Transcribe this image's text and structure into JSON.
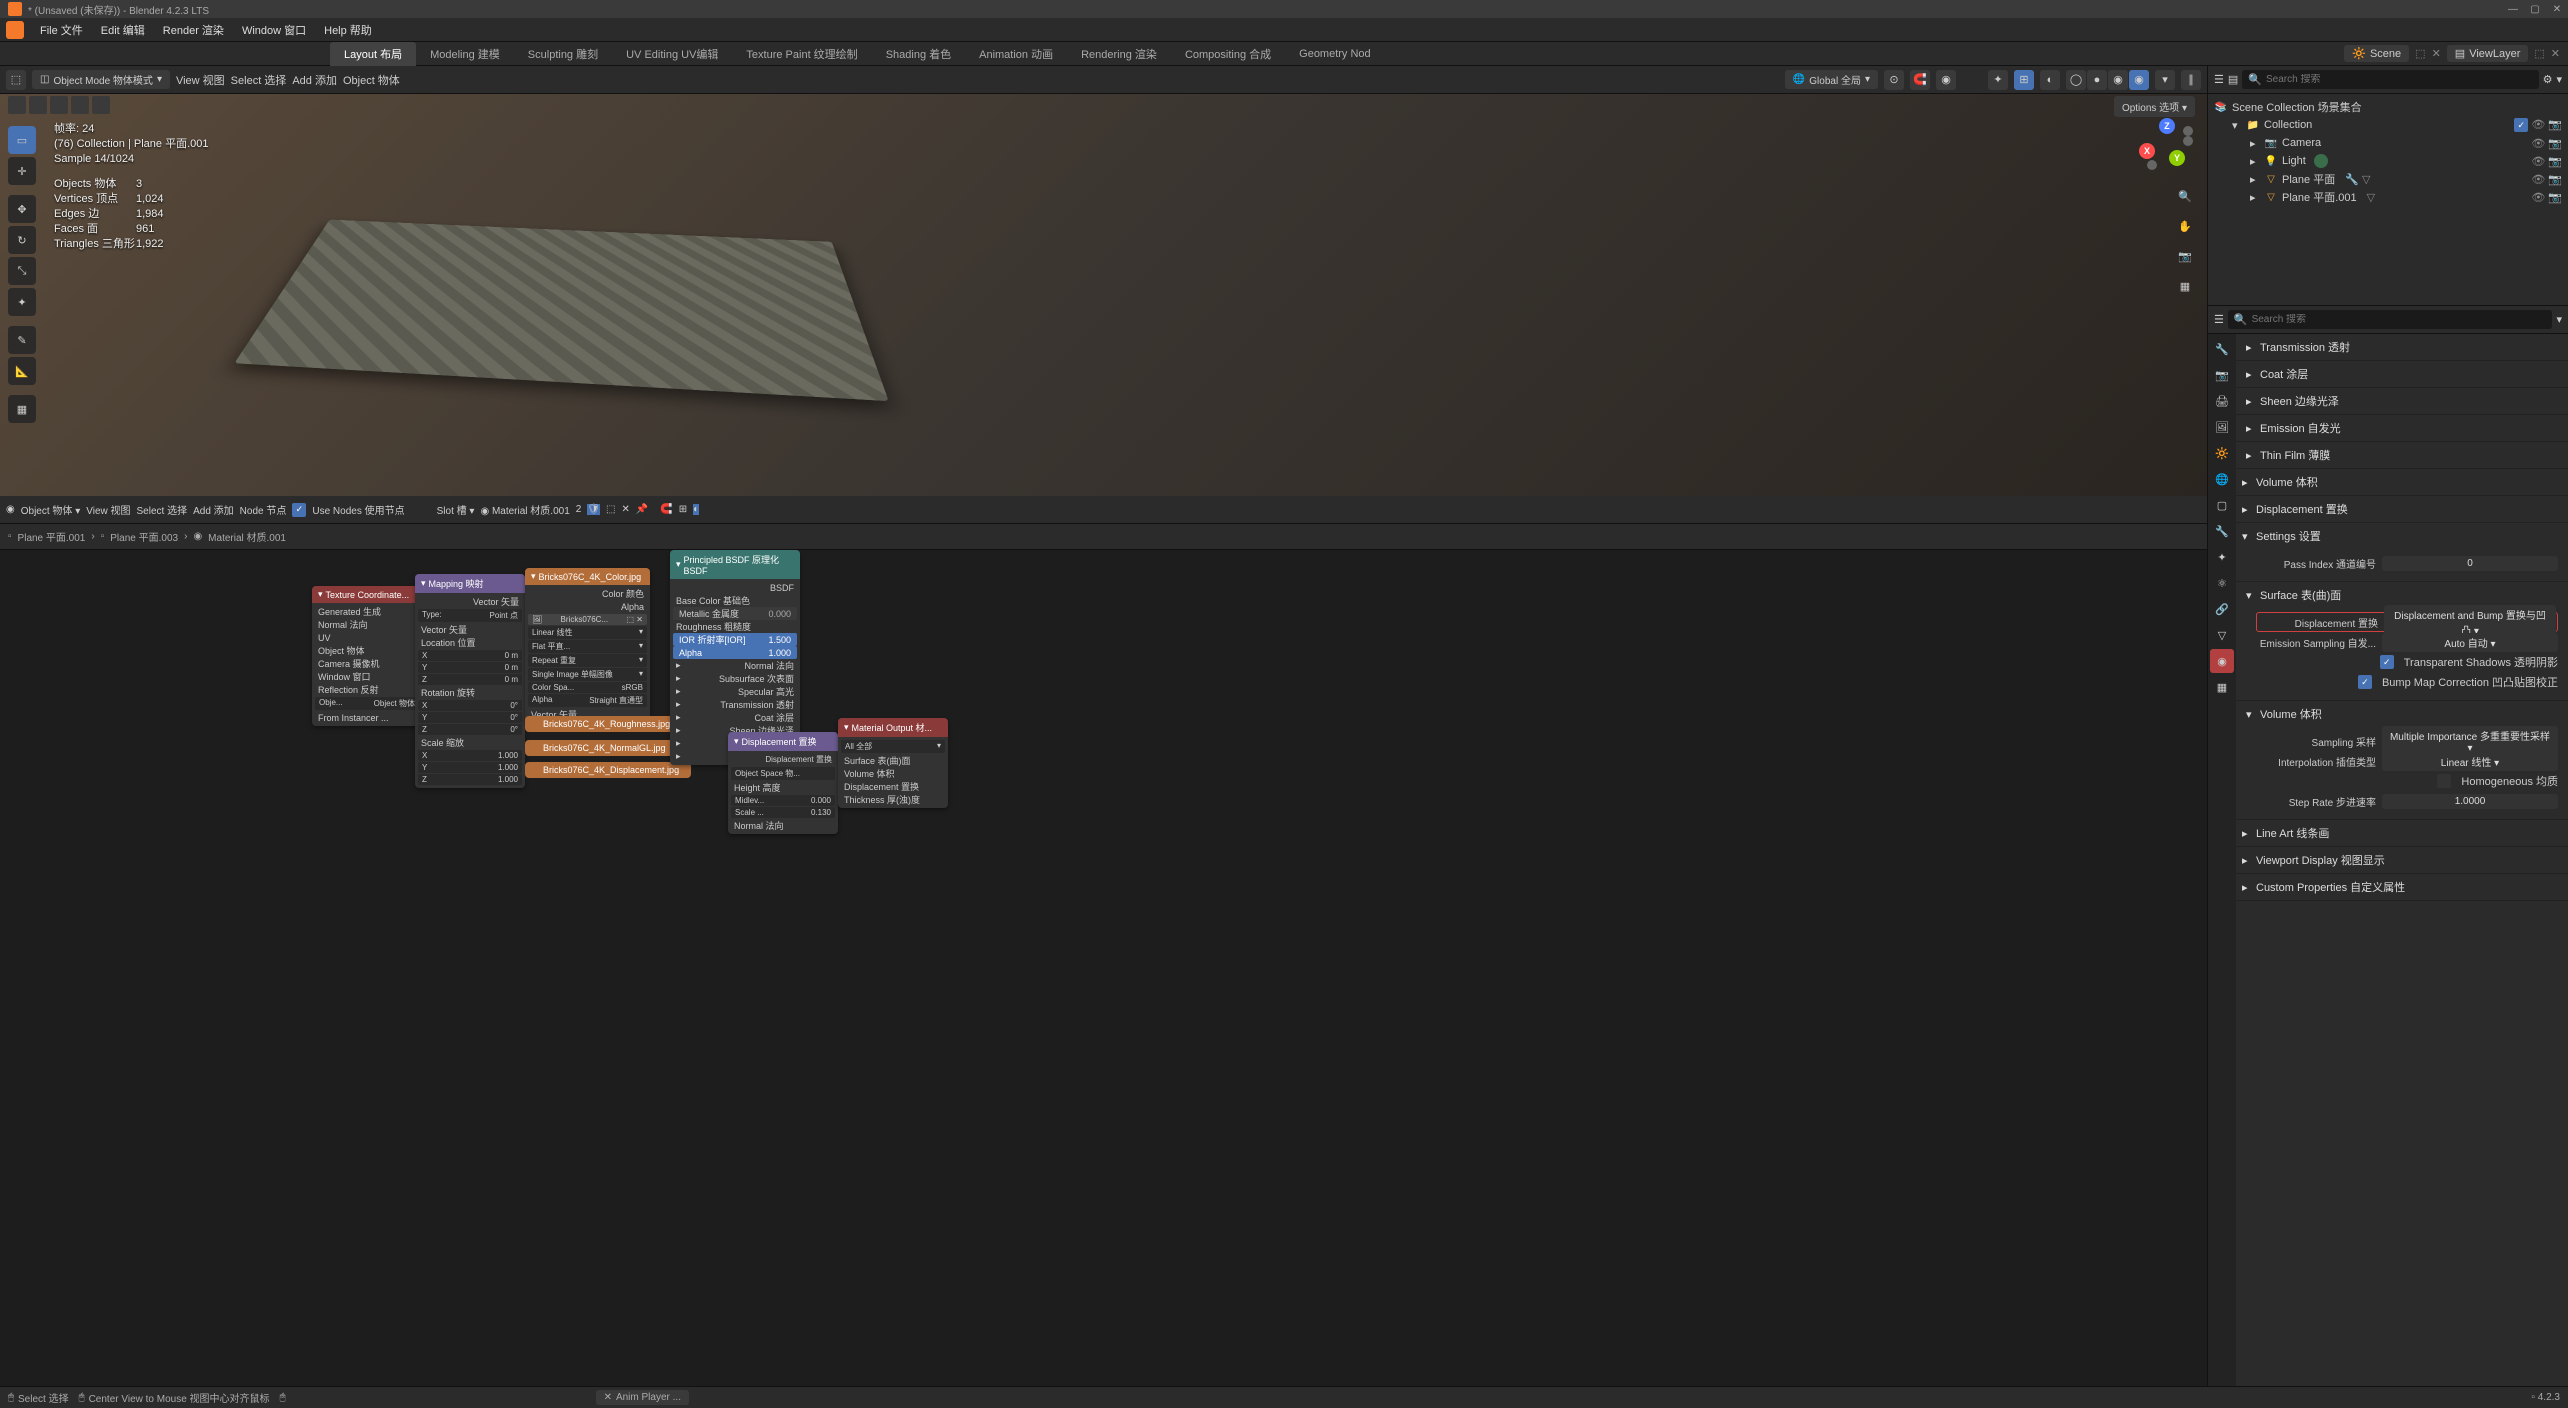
{
  "app": {
    "title": "* (Unsaved (未保存)) - Blender 4.2.3 LTS",
    "version": "4.2.3"
  },
  "menu": [
    "File 文件",
    "Edit 编辑",
    "Render 渲染",
    "Window 窗口",
    "Help 帮助"
  ],
  "workspaces": [
    "Layout 布局",
    "Modeling 建模",
    "Sculpting 雕刻",
    "UV Editing UV编辑",
    "Texture Paint 纹理绘制",
    "Shading 着色",
    "Animation 动画",
    "Rendering 渲染",
    "Compositing 合成",
    "Geometry Nod"
  ],
  "scene_field": "Scene",
  "viewlayer_field": "ViewLayer",
  "viewport_header": {
    "mode": "Object Mode 物体模式",
    "view": "View 视图",
    "select": "Select 选择",
    "add": "Add 添加",
    "object": "Object 物体",
    "orientation": "Global 全局",
    "options": "Options 选项"
  },
  "vp_info": {
    "fps": "帧率: 24",
    "path": "(76) Collection | Plane 平面.001",
    "sample": "Sample 14/1024",
    "stats": [
      {
        "l": "Objects 物体",
        "v": "3"
      },
      {
        "l": "Vertices 顶点",
        "v": "1,024"
      },
      {
        "l": "Edges 边",
        "v": "1,984"
      },
      {
        "l": "Faces 面",
        "v": "961"
      },
      {
        "l": "Triangles 三角形",
        "v": "1,922"
      }
    ]
  },
  "gizmo": {
    "x": "X",
    "y": "Y",
    "z": "Z"
  },
  "outliner": {
    "search_placeholder": "Search 搜索",
    "root": "Scene Collection 场景集合",
    "collection": "Collection",
    "items": [
      {
        "name": "Camera",
        "icon": "camera"
      },
      {
        "name": "Light",
        "icon": "light"
      },
      {
        "name": "Plane 平面",
        "icon": "mesh"
      },
      {
        "name": "Plane 平面.001",
        "icon": "mesh"
      }
    ]
  },
  "node_editor": {
    "header": {
      "mode": "Object 物体",
      "view": "View 视图",
      "select": "Select 选择",
      "add": "Add 添加",
      "node": "Node 节点",
      "use_nodes": "Use Nodes 使用节点",
      "slot": "Slot 槽",
      "material": "Material 材质.001",
      "users": "2"
    },
    "breadcrumb": [
      "Plane 平面.001",
      "Plane 平面.003",
      "Material 材质.001"
    ],
    "nodes": {
      "texcoord": {
        "title": "Texture Coordinate...",
        "outs": [
          "Generated 生成",
          "Normal 法向",
          "UV",
          "Object 物体",
          "Camera 摄像机",
          "Window 窗口",
          "Reflection 反射"
        ],
        "obj_label": "Obje...",
        "obj_value": "Object 物体",
        "from_inst": "From Instancer ..."
      },
      "mapping": {
        "title": "Mapping 映射",
        "vector_out": "Vector 矢量",
        "type_label": "Type:",
        "type_value": "Point 点",
        "vector_in": "Vector 矢量",
        "loc": "Location 位置",
        "rot": "Rotation 旋转",
        "scale": "Scale 缩放",
        "xyz": [
          {
            "a": "X",
            "v": "0 m"
          },
          {
            "a": "Y",
            "v": "0 m"
          },
          {
            "a": "Z",
            "v": "0 m"
          }
        ],
        "rot_xyz": [
          {
            "a": "X",
            "v": "0°"
          },
          {
            "a": "Y",
            "v": "0°"
          },
          {
            "a": "Z",
            "v": "0°"
          }
        ],
        "scale_xyz": [
          {
            "a": "X",
            "v": "1.000"
          },
          {
            "a": "Y",
            "v": "1.000"
          },
          {
            "a": "Z",
            "v": "1.000"
          }
        ]
      },
      "imgtex": {
        "title": "Bricks076C_4K_Color.jpg",
        "color": "Color 颜色",
        "alpha": "Alpha",
        "img": "Bricks076C...",
        "linear": "Linear 线性",
        "flat": "Flat 平直...",
        "repeat": "Repeat 重复",
        "single": "Single Image 单幅图像",
        "cspace_l": "Color Spa...",
        "cspace_v": "sRGB",
        "alpha_l": "Alpha",
        "alpha_v": "Straight 直通型",
        "vector": "Vector 矢量"
      },
      "img_rough": "Bricks076C_4K_Roughness.jpg",
      "img_normal": "Bricks076C_4K_NormalGL.jpg",
      "img_disp": "Bricks076C_4K_Displacement.jpg",
      "bsdf": {
        "title": "Principled BSDF 原理化 BSDF",
        "out": "BSDF",
        "rows": [
          {
            "l": "Base Color 基础色",
            "v": ""
          },
          {
            "l": "Metallic 金属度",
            "v": "0.000"
          },
          {
            "l": "Roughness 粗糙度",
            "v": ""
          },
          {
            "l": "IOR 折射率[IOR]",
            "v": "1.500"
          },
          {
            "l": "Alpha",
            "v": "1.000"
          },
          {
            "l": "Normal 法向",
            "v": ""
          },
          {
            "l": "Subsurface 次表面",
            "v": ""
          },
          {
            "l": "Specular 高光",
            "v": ""
          },
          {
            "l": "Transmission 透射",
            "v": ""
          },
          {
            "l": "Coat 涂层",
            "v": ""
          },
          {
            "l": "Sheen 边缘光泽",
            "v": ""
          },
          {
            "l": "Emission 自发光",
            "v": ""
          },
          {
            "l": "Thin Film 薄膜",
            "v": ""
          }
        ]
      },
      "displacement": {
        "title": "Displacement 置换",
        "out": "Displacement 置换",
        "space": "Object Space 物...",
        "rows": [
          {
            "l": "Height 高度",
            "v": ""
          },
          {
            "l": "Midlev...",
            "v": "0.000"
          },
          {
            "l": "Scale ...",
            "v": "0.130"
          },
          {
            "l": "Normal 法向",
            "v": ""
          }
        ]
      },
      "output": {
        "title": "Material Output 材...",
        "all": "All 全部",
        "rows": [
          "Surface 表(曲)面",
          "Volume 体积",
          "Displacement 置换",
          "Thickness 厚(浊)度"
        ]
      }
    }
  },
  "properties": {
    "search_placeholder": "Search 搜索",
    "sections_top": [
      "Transmission 透射",
      "Coat 涂层",
      "Sheen 边缘光泽",
      "Emission 自发光",
      "Thin Film 薄膜"
    ],
    "volume": "Volume 体积",
    "displacement": "Displacement 置换",
    "settings_title": "Settings 设置",
    "pass_index": {
      "l": "Pass Index 通道编号",
      "v": "0"
    },
    "surface_title": "Surface 表(曲)面",
    "disp_row": {
      "l": "Displacement 置换",
      "v": "Displacement and Bump 置换与凹凸"
    },
    "emit_sampling": {
      "l": "Emission Sampling 自发...",
      "v": "Auto 自动"
    },
    "transparent_shadows": "Transparent Shadows 透明阴影",
    "bump_correction": "Bump Map Correction 凹凸贴图校正",
    "volume_title": "Volume 体积",
    "sampling": {
      "l": "Sampling 采样",
      "v": "Multiple Importance 多重重要性采样"
    },
    "interp": {
      "l": "Interpolation 插值类型",
      "v": "Linear 线性"
    },
    "homogeneous": "Homogeneous 均质",
    "step_rate": {
      "l": "Step Rate 步进速率",
      "v": "1.0000"
    },
    "sections_bottom": [
      "Line Art 线条画",
      "Viewport Display 视图显示",
      "Custom Properties 自定义属性"
    ]
  },
  "status": {
    "select": "Select 选择",
    "center": "Center View to Mouse 视图中心对齐鼠标",
    "anim": "Anim Player ..."
  }
}
